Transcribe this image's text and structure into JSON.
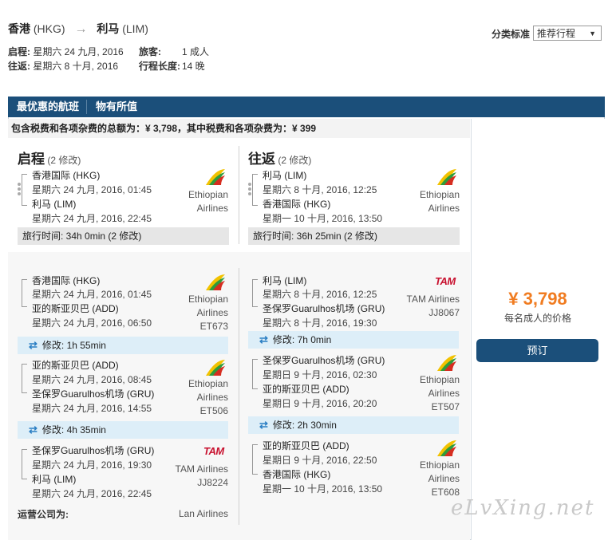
{
  "header": {
    "origin_city": "香港",
    "origin_code": "(HKG)",
    "arrow": "→",
    "dest_city": "利马",
    "dest_code": "(LIM)",
    "depart_label": "启程:",
    "depart_date": "星期六 24 九月, 2016",
    "return_label": "往返:",
    "return_date": "星期六 8 十月, 2016",
    "passengers_label": "旅客:",
    "passengers_value": "1 成人",
    "trip_length_label": "行程长度:",
    "trip_length_value": "14 晚"
  },
  "sort": {
    "label": "分类标准",
    "value": "推荐行程",
    "caret": "▼"
  },
  "tabs": [
    "最优惠的航班",
    "物有所值"
  ],
  "price_summary": "包含税费和各项杂费的总额为：¥ 3,798，其中税费和各项杂费为：¥ 399",
  "summary": {
    "outbound": {
      "title": "启程",
      "stops": "(2 修改)",
      "from": "香港国际 (HKG)",
      "from_time": "星期六 24 九月, 2016, 01:45",
      "to": "利马 (LIM)",
      "to_time": "星期六 24 九月, 2016, 22:45",
      "airline_line1": "Ethiopian",
      "airline_line2": "Airlines",
      "duration": "旅行时间: 34h 0min (2 修改)"
    },
    "return": {
      "title": "往返",
      "stops": "(2 修改)",
      "from": "利马 (LIM)",
      "from_time": "星期六 8 十月, 2016, 12:25",
      "to": "香港国际 (HKG)",
      "to_time": "星期一 10 十月, 2016, 13:50",
      "airline_line1": "Ethiopian",
      "airline_line2": "Airlines",
      "duration": "旅行时间: 36h 25min (2 修改)"
    }
  },
  "outbound_segments": [
    {
      "from": "香港国际 (HKG)",
      "dep": "星期六 24 九月, 2016, 01:45",
      "to": "亚的斯亚贝巴 (ADD)",
      "arr": "星期六 24 九月, 2016, 06:50",
      "airline1": "Ethiopian",
      "airline2": "Airlines",
      "flight": "ET673"
    },
    {
      "from": "亚的斯亚贝巴 (ADD)",
      "dep": "星期六 24 九月, 2016, 08:45",
      "to": "圣保罗Guarulhos机场 (GRU)",
      "arr": "星期六 24 九月, 2016, 14:55",
      "airline1": "Ethiopian",
      "airline2": "Airlines",
      "flight": "ET506"
    },
    {
      "from": "圣保罗Guarulhos机场 (GRU)",
      "dep": "星期六 24 九月, 2016, 19:30",
      "to": "利马 (LIM)",
      "arr": "星期六 24 九月, 2016, 22:45",
      "airline1": "TAM Airlines",
      "airline2": "",
      "flight": "JJ8224"
    }
  ],
  "outbound_layovers": [
    "修改: 1h 55min",
    "修改: 4h 35min"
  ],
  "return_segments": [
    {
      "from": "利马 (LIM)",
      "dep": "星期六 8 十月, 2016, 12:25",
      "to": "圣保罗Guarulhos机场 (GRU)",
      "arr": "星期六 8 十月, 2016, 19:30",
      "airline1": "TAM Airlines",
      "airline2": "",
      "flight": "JJ8067"
    },
    {
      "from": "圣保罗Guarulhos机场 (GRU)",
      "dep": "星期日 9 十月, 2016, 02:30",
      "to": "亚的斯亚贝巴 (ADD)",
      "arr": "星期日 9 十月, 2016, 20:20",
      "airline1": "Ethiopian",
      "airline2": "Airlines",
      "flight": "ET507"
    },
    {
      "from": "亚的斯亚贝巴 (ADD)",
      "dep": "星期日 9 十月, 2016, 22:50",
      "to": "香港国际 (HKG)",
      "arr": "星期一 10 十月, 2016, 13:50",
      "airline1": "Ethiopian",
      "airline2": "Airlines",
      "flight": "ET608"
    }
  ],
  "return_layovers": [
    "修改: 7h 0min",
    "修改: 2h 30min"
  ],
  "operated_by_label": "运营公司为:",
  "operated_by_value": "Lan Airlines",
  "tam_logo_text": "TAM",
  "layover_icon": "⇄",
  "price": {
    "amount": "¥ 3,798",
    "per_adult": "每名成人的价格",
    "book_label": "预订"
  },
  "watermark": "eLvXing.net",
  "colors": {
    "brand": "#1b4f7a",
    "price": "#f07c21",
    "layover_bg": "#ddeef8",
    "tam_red": "#c8102e"
  }
}
